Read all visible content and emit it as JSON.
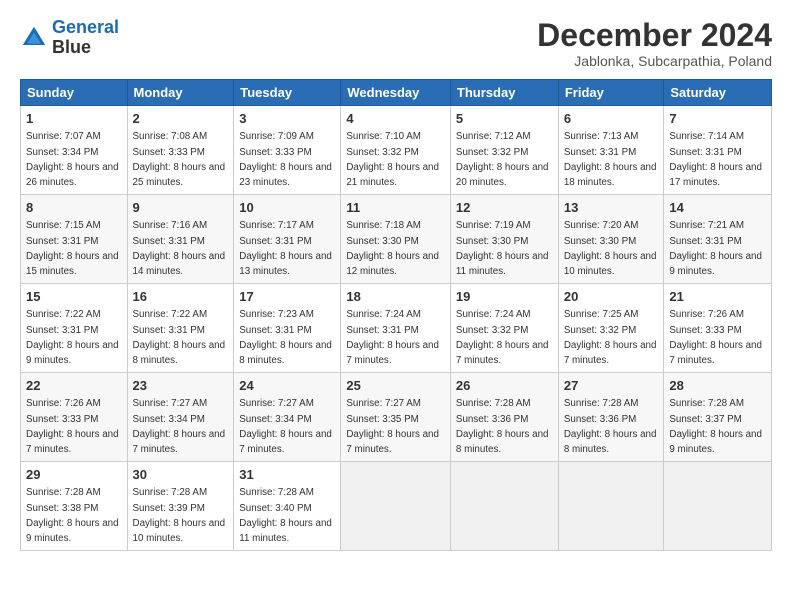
{
  "logo": {
    "line1": "General",
    "line2": "Blue"
  },
  "title": "December 2024",
  "subtitle": "Jablonka, Subcarpathia, Poland",
  "header_days": [
    "Sunday",
    "Monday",
    "Tuesday",
    "Wednesday",
    "Thursday",
    "Friday",
    "Saturday"
  ],
  "weeks": [
    [
      {
        "day": "1",
        "rise": "Sunrise: 7:07 AM",
        "set": "Sunset: 3:34 PM",
        "daylight": "Daylight: 8 hours and 26 minutes."
      },
      {
        "day": "2",
        "rise": "Sunrise: 7:08 AM",
        "set": "Sunset: 3:33 PM",
        "daylight": "Daylight: 8 hours and 25 minutes."
      },
      {
        "day": "3",
        "rise": "Sunrise: 7:09 AM",
        "set": "Sunset: 3:33 PM",
        "daylight": "Daylight: 8 hours and 23 minutes."
      },
      {
        "day": "4",
        "rise": "Sunrise: 7:10 AM",
        "set": "Sunset: 3:32 PM",
        "daylight": "Daylight: 8 hours and 21 minutes."
      },
      {
        "day": "5",
        "rise": "Sunrise: 7:12 AM",
        "set": "Sunset: 3:32 PM",
        "daylight": "Daylight: 8 hours and 20 minutes."
      },
      {
        "day": "6",
        "rise": "Sunrise: 7:13 AM",
        "set": "Sunset: 3:31 PM",
        "daylight": "Daylight: 8 hours and 18 minutes."
      },
      {
        "day": "7",
        "rise": "Sunrise: 7:14 AM",
        "set": "Sunset: 3:31 PM",
        "daylight": "Daylight: 8 hours and 17 minutes."
      }
    ],
    [
      {
        "day": "8",
        "rise": "Sunrise: 7:15 AM",
        "set": "Sunset: 3:31 PM",
        "daylight": "Daylight: 8 hours and 15 minutes."
      },
      {
        "day": "9",
        "rise": "Sunrise: 7:16 AM",
        "set": "Sunset: 3:31 PM",
        "daylight": "Daylight: 8 hours and 14 minutes."
      },
      {
        "day": "10",
        "rise": "Sunrise: 7:17 AM",
        "set": "Sunset: 3:31 PM",
        "daylight": "Daylight: 8 hours and 13 minutes."
      },
      {
        "day": "11",
        "rise": "Sunrise: 7:18 AM",
        "set": "Sunset: 3:30 PM",
        "daylight": "Daylight: 8 hours and 12 minutes."
      },
      {
        "day": "12",
        "rise": "Sunrise: 7:19 AM",
        "set": "Sunset: 3:30 PM",
        "daylight": "Daylight: 8 hours and 11 minutes."
      },
      {
        "day": "13",
        "rise": "Sunrise: 7:20 AM",
        "set": "Sunset: 3:30 PM",
        "daylight": "Daylight: 8 hours and 10 minutes."
      },
      {
        "day": "14",
        "rise": "Sunrise: 7:21 AM",
        "set": "Sunset: 3:31 PM",
        "daylight": "Daylight: 8 hours and 9 minutes."
      }
    ],
    [
      {
        "day": "15",
        "rise": "Sunrise: 7:22 AM",
        "set": "Sunset: 3:31 PM",
        "daylight": "Daylight: 8 hours and 9 minutes."
      },
      {
        "day": "16",
        "rise": "Sunrise: 7:22 AM",
        "set": "Sunset: 3:31 PM",
        "daylight": "Daylight: 8 hours and 8 minutes."
      },
      {
        "day": "17",
        "rise": "Sunrise: 7:23 AM",
        "set": "Sunset: 3:31 PM",
        "daylight": "Daylight: 8 hours and 8 minutes."
      },
      {
        "day": "18",
        "rise": "Sunrise: 7:24 AM",
        "set": "Sunset: 3:31 PM",
        "daylight": "Daylight: 8 hours and 7 minutes."
      },
      {
        "day": "19",
        "rise": "Sunrise: 7:24 AM",
        "set": "Sunset: 3:32 PM",
        "daylight": "Daylight: 8 hours and 7 minutes."
      },
      {
        "day": "20",
        "rise": "Sunrise: 7:25 AM",
        "set": "Sunset: 3:32 PM",
        "daylight": "Daylight: 8 hours and 7 minutes."
      },
      {
        "day": "21",
        "rise": "Sunrise: 7:26 AM",
        "set": "Sunset: 3:33 PM",
        "daylight": "Daylight: 8 hours and 7 minutes."
      }
    ],
    [
      {
        "day": "22",
        "rise": "Sunrise: 7:26 AM",
        "set": "Sunset: 3:33 PM",
        "daylight": "Daylight: 8 hours and 7 minutes."
      },
      {
        "day": "23",
        "rise": "Sunrise: 7:27 AM",
        "set": "Sunset: 3:34 PM",
        "daylight": "Daylight: 8 hours and 7 minutes."
      },
      {
        "day": "24",
        "rise": "Sunrise: 7:27 AM",
        "set": "Sunset: 3:34 PM",
        "daylight": "Daylight: 8 hours and 7 minutes."
      },
      {
        "day": "25",
        "rise": "Sunrise: 7:27 AM",
        "set": "Sunset: 3:35 PM",
        "daylight": "Daylight: 8 hours and 7 minutes."
      },
      {
        "day": "26",
        "rise": "Sunrise: 7:28 AM",
        "set": "Sunset: 3:36 PM",
        "daylight": "Daylight: 8 hours and 8 minutes."
      },
      {
        "day": "27",
        "rise": "Sunrise: 7:28 AM",
        "set": "Sunset: 3:36 PM",
        "daylight": "Daylight: 8 hours and 8 minutes."
      },
      {
        "day": "28",
        "rise": "Sunrise: 7:28 AM",
        "set": "Sunset: 3:37 PM",
        "daylight": "Daylight: 8 hours and 9 minutes."
      }
    ],
    [
      {
        "day": "29",
        "rise": "Sunrise: 7:28 AM",
        "set": "Sunset: 3:38 PM",
        "daylight": "Daylight: 8 hours and 9 minutes."
      },
      {
        "day": "30",
        "rise": "Sunrise: 7:28 AM",
        "set": "Sunset: 3:39 PM",
        "daylight": "Daylight: 8 hours and 10 minutes."
      },
      {
        "day": "31",
        "rise": "Sunrise: 7:28 AM",
        "set": "Sunset: 3:40 PM",
        "daylight": "Daylight: 8 hours and 11 minutes."
      },
      null,
      null,
      null,
      null
    ]
  ]
}
